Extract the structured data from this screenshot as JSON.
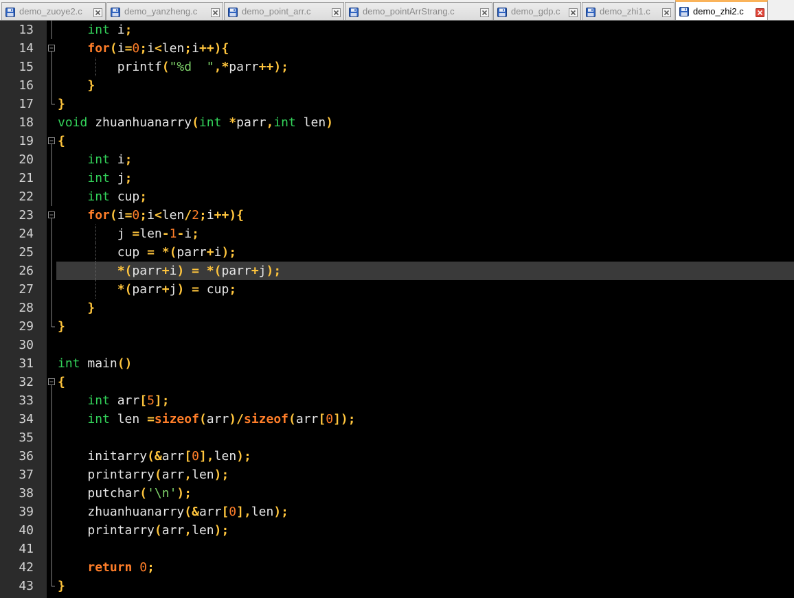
{
  "colors": {
    "background": "#000000",
    "gutter": "#2b2b2b",
    "current_line": "#3a3a3a",
    "type_keyword": "#33d35a",
    "control_keyword": "#ff7e29",
    "operator": "#ffc53d",
    "number": "#ff7e29",
    "string": "#7fd36a",
    "identifier": "#e6e6e6",
    "active_tab_accent": "#fab35a"
  },
  "tabs": [
    {
      "label": "demo_zuoye2.c",
      "active": false,
      "icon": "save-icon"
    },
    {
      "label": "demo_yanzheng.c",
      "active": false,
      "icon": "save-icon"
    },
    {
      "label": "demo_point_arr.c",
      "active": false,
      "icon": "save-icon"
    },
    {
      "label": "demo_pointArrStrang.c",
      "active": false,
      "icon": "save-icon"
    },
    {
      "label": "demo_gdp.c",
      "active": false,
      "icon": "save-icon"
    },
    {
      "label": "demo_zhi1.c",
      "active": false,
      "icon": "save-icon"
    },
    {
      "label": "demo_zhi2.c",
      "active": true,
      "icon": "save-icon"
    }
  ],
  "editor": {
    "current_line": 26,
    "lines": [
      {
        "no": "13",
        "fold": "line",
        "guides": [],
        "tokens": [
          [
            "ws",
            "    "
          ],
          [
            "type",
            "int"
          ],
          [
            "id",
            " i"
          ],
          [
            "op",
            ";"
          ]
        ]
      },
      {
        "no": "14",
        "fold": "minus",
        "guides": [],
        "tokens": [
          [
            "ws",
            "    "
          ],
          [
            "kw",
            "for"
          ],
          [
            "op",
            "("
          ],
          [
            "id",
            "i"
          ],
          [
            "op",
            "="
          ],
          [
            "num",
            "0"
          ],
          [
            "op",
            ";"
          ],
          [
            "id",
            "i"
          ],
          [
            "op",
            "<"
          ],
          [
            "id",
            "len"
          ],
          [
            "op",
            ";"
          ],
          [
            "id",
            "i"
          ],
          [
            "op",
            "++){"
          ]
        ]
      },
      {
        "no": "15",
        "fold": "line",
        "guides": [
          4
        ],
        "tokens": [
          [
            "ws",
            "        "
          ],
          [
            "id",
            "printf"
          ],
          [
            "op",
            "("
          ],
          [
            "str",
            "\"%d  \""
          ],
          [
            "op",
            ",*"
          ],
          [
            "id",
            "parr"
          ],
          [
            "op",
            "++);"
          ]
        ]
      },
      {
        "no": "16",
        "fold": "line",
        "guides": [],
        "tokens": [
          [
            "ws",
            "    "
          ],
          [
            "op",
            "}"
          ]
        ]
      },
      {
        "no": "17",
        "fold": "end",
        "guides": [],
        "tokens": [
          [
            "op",
            "}"
          ]
        ]
      },
      {
        "no": "18",
        "fold": "none",
        "guides": [],
        "tokens": [
          [
            "type",
            "void"
          ],
          [
            "id",
            " zhuanhuanarry"
          ],
          [
            "op",
            "("
          ],
          [
            "type",
            "int"
          ],
          [
            "id",
            " "
          ],
          [
            "op",
            "*"
          ],
          [
            "id",
            "parr"
          ],
          [
            "op",
            ","
          ],
          [
            "type",
            "int"
          ],
          [
            "id",
            " len"
          ],
          [
            "op",
            ")"
          ]
        ]
      },
      {
        "no": "19",
        "fold": "minus",
        "guides": [],
        "tokens": [
          [
            "op",
            "{"
          ]
        ]
      },
      {
        "no": "20",
        "fold": "line",
        "guides": [],
        "tokens": [
          [
            "ws",
            "    "
          ],
          [
            "type",
            "int"
          ],
          [
            "id",
            " i"
          ],
          [
            "op",
            ";"
          ]
        ]
      },
      {
        "no": "21",
        "fold": "line",
        "guides": [],
        "tokens": [
          [
            "ws",
            "    "
          ],
          [
            "type",
            "int"
          ],
          [
            "id",
            " j"
          ],
          [
            "op",
            ";"
          ]
        ]
      },
      {
        "no": "22",
        "fold": "line",
        "guides": [],
        "tokens": [
          [
            "ws",
            "    "
          ],
          [
            "type",
            "int"
          ],
          [
            "id",
            " cup"
          ],
          [
            "op",
            ";"
          ]
        ]
      },
      {
        "no": "23",
        "fold": "minus",
        "guides": [],
        "tokens": [
          [
            "ws",
            "    "
          ],
          [
            "kw",
            "for"
          ],
          [
            "op",
            "("
          ],
          [
            "id",
            "i"
          ],
          [
            "op",
            "="
          ],
          [
            "num",
            "0"
          ],
          [
            "op",
            ";"
          ],
          [
            "id",
            "i"
          ],
          [
            "op",
            "<"
          ],
          [
            "id",
            "len"
          ],
          [
            "op",
            "/"
          ],
          [
            "num",
            "2"
          ],
          [
            "op",
            ";"
          ],
          [
            "id",
            "i"
          ],
          [
            "op",
            "++){"
          ]
        ]
      },
      {
        "no": "24",
        "fold": "line",
        "guides": [
          4
        ],
        "tokens": [
          [
            "ws",
            "        "
          ],
          [
            "id",
            "j "
          ],
          [
            "op",
            "="
          ],
          [
            "id",
            "len"
          ],
          [
            "op",
            "-"
          ],
          [
            "num",
            "1"
          ],
          [
            "op",
            "-"
          ],
          [
            "id",
            "i"
          ],
          [
            "op",
            ";"
          ]
        ]
      },
      {
        "no": "25",
        "fold": "line",
        "guides": [
          4
        ],
        "tokens": [
          [
            "ws",
            "        "
          ],
          [
            "id",
            "cup "
          ],
          [
            "op",
            "= *("
          ],
          [
            "id",
            "parr"
          ],
          [
            "op",
            "+"
          ],
          [
            "id",
            "i"
          ],
          [
            "op",
            ");"
          ]
        ]
      },
      {
        "no": "26",
        "fold": "line",
        "guides": [
          4
        ],
        "tokens": [
          [
            "ws",
            "        "
          ],
          [
            "op",
            "*("
          ],
          [
            "id",
            "parr"
          ],
          [
            "op",
            "+"
          ],
          [
            "id",
            "i"
          ],
          [
            "op",
            ") = *("
          ],
          [
            "id",
            "parr"
          ],
          [
            "op",
            "+"
          ],
          [
            "id",
            "j"
          ],
          [
            "op",
            ");"
          ]
        ]
      },
      {
        "no": "27",
        "fold": "line",
        "guides": [
          4
        ],
        "tokens": [
          [
            "ws",
            "        "
          ],
          [
            "op",
            "*("
          ],
          [
            "id",
            "parr"
          ],
          [
            "op",
            "+"
          ],
          [
            "id",
            "j"
          ],
          [
            "op",
            ") = "
          ],
          [
            "id",
            "cup"
          ],
          [
            "op",
            ";"
          ]
        ]
      },
      {
        "no": "28",
        "fold": "line",
        "guides": [],
        "tokens": [
          [
            "ws",
            "    "
          ],
          [
            "op",
            "}"
          ]
        ]
      },
      {
        "no": "29",
        "fold": "end",
        "guides": [],
        "tokens": [
          [
            "op",
            "}"
          ]
        ]
      },
      {
        "no": "30",
        "fold": "none",
        "guides": [],
        "tokens": []
      },
      {
        "no": "31",
        "fold": "none",
        "guides": [],
        "tokens": [
          [
            "type",
            "int"
          ],
          [
            "id",
            " main"
          ],
          [
            "op",
            "()"
          ]
        ]
      },
      {
        "no": "32",
        "fold": "minus",
        "guides": [],
        "tokens": [
          [
            "op",
            "{"
          ]
        ]
      },
      {
        "no": "33",
        "fold": "line",
        "guides": [],
        "tokens": [
          [
            "ws",
            "    "
          ],
          [
            "type",
            "int"
          ],
          [
            "id",
            " arr"
          ],
          [
            "op",
            "["
          ],
          [
            "num",
            "5"
          ],
          [
            "op",
            "];"
          ]
        ]
      },
      {
        "no": "34",
        "fold": "line",
        "guides": [],
        "tokens": [
          [
            "ws",
            "    "
          ],
          [
            "type",
            "int"
          ],
          [
            "id",
            " len "
          ],
          [
            "op",
            "="
          ],
          [
            "kw",
            "sizeof"
          ],
          [
            "op",
            "("
          ],
          [
            "id",
            "arr"
          ],
          [
            "op",
            ")/"
          ],
          [
            "kw",
            "sizeof"
          ],
          [
            "op",
            "("
          ],
          [
            "id",
            "arr"
          ],
          [
            "op",
            "["
          ],
          [
            "num",
            "0"
          ],
          [
            "op",
            "]);"
          ]
        ]
      },
      {
        "no": "35",
        "fold": "line",
        "guides": [],
        "tokens": []
      },
      {
        "no": "36",
        "fold": "line",
        "guides": [],
        "tokens": [
          [
            "ws",
            "    "
          ],
          [
            "id",
            "initarry"
          ],
          [
            "op",
            "(&"
          ],
          [
            "id",
            "arr"
          ],
          [
            "op",
            "["
          ],
          [
            "num",
            "0"
          ],
          [
            "op",
            "],"
          ],
          [
            "id",
            "len"
          ],
          [
            "op",
            ");"
          ]
        ]
      },
      {
        "no": "37",
        "fold": "line",
        "guides": [],
        "tokens": [
          [
            "ws",
            "    "
          ],
          [
            "id",
            "printarry"
          ],
          [
            "op",
            "("
          ],
          [
            "id",
            "arr"
          ],
          [
            "op",
            ","
          ],
          [
            "id",
            "len"
          ],
          [
            "op",
            ");"
          ]
        ]
      },
      {
        "no": "38",
        "fold": "line",
        "guides": [],
        "tokens": [
          [
            "ws",
            "    "
          ],
          [
            "id",
            "putchar"
          ],
          [
            "op",
            "("
          ],
          [
            "str",
            "'\\n'"
          ],
          [
            "op",
            ");"
          ]
        ]
      },
      {
        "no": "39",
        "fold": "line",
        "guides": [],
        "tokens": [
          [
            "ws",
            "    "
          ],
          [
            "id",
            "zhuanhuanarry"
          ],
          [
            "op",
            "(&"
          ],
          [
            "id",
            "arr"
          ],
          [
            "op",
            "["
          ],
          [
            "num",
            "0"
          ],
          [
            "op",
            "],"
          ],
          [
            "id",
            "len"
          ],
          [
            "op",
            ");"
          ]
        ]
      },
      {
        "no": "40",
        "fold": "line",
        "guides": [],
        "tokens": [
          [
            "ws",
            "    "
          ],
          [
            "id",
            "printarry"
          ],
          [
            "op",
            "("
          ],
          [
            "id",
            "arr"
          ],
          [
            "op",
            ","
          ],
          [
            "id",
            "len"
          ],
          [
            "op",
            ");"
          ]
        ]
      },
      {
        "no": "41",
        "fold": "line",
        "guides": [],
        "tokens": []
      },
      {
        "no": "42",
        "fold": "line",
        "guides": [],
        "tokens": [
          [
            "ws",
            "    "
          ],
          [
            "kw",
            "return"
          ],
          [
            "id",
            " "
          ],
          [
            "num",
            "0"
          ],
          [
            "op",
            ";"
          ]
        ]
      },
      {
        "no": "43",
        "fold": "end",
        "guides": [],
        "tokens": [
          [
            "op",
            "}"
          ]
        ]
      }
    ]
  }
}
